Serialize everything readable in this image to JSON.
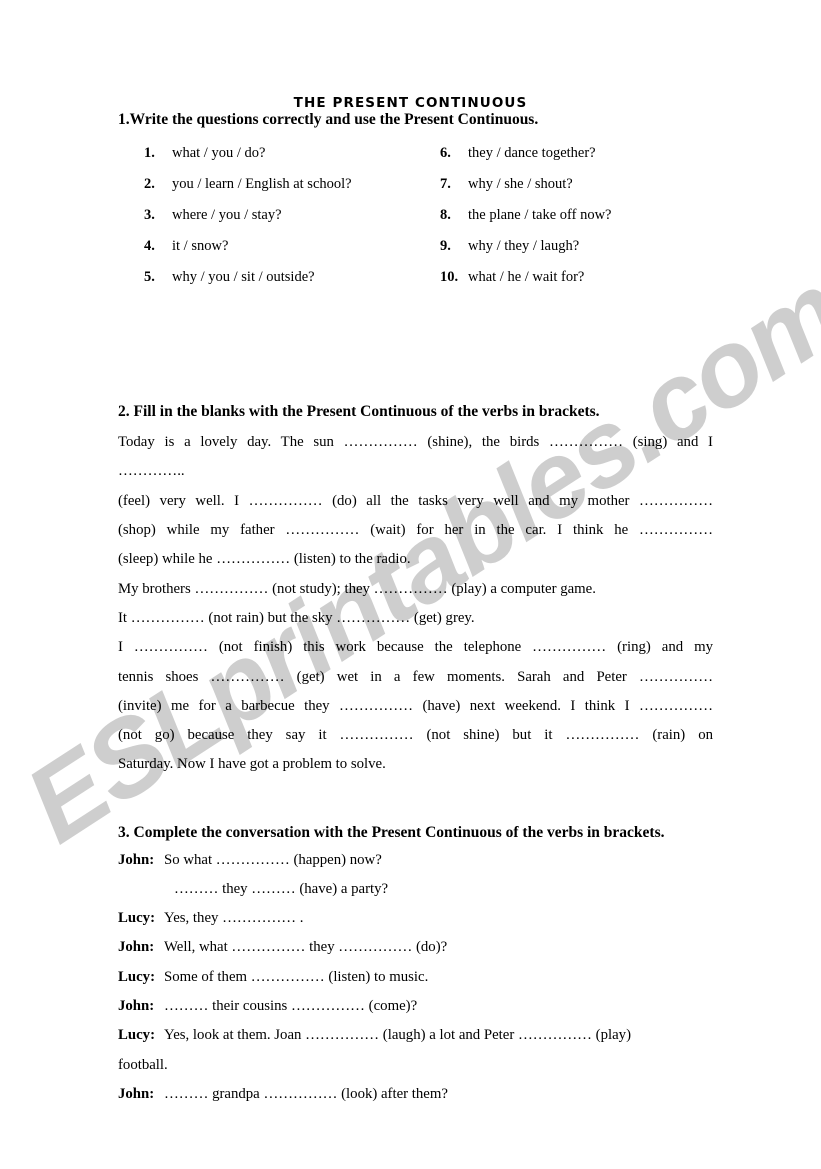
{
  "document": {
    "title": "THE PRESENT CONTINUOUS",
    "watermark": "ESLprintables.com",
    "watermark_color": "#cccccc",
    "page_background": "#ffffff",
    "text_color": "#000000",
    "blank_color": "#8e8e8e"
  },
  "exercise1": {
    "heading": "1.Write the questions correctly and use the Present Continuous.",
    "items_left": [
      {
        "num": "1.",
        "text": "what / you / do?"
      },
      {
        "num": "2.",
        "text": "you / learn / English at school?"
      },
      {
        "num": "3.",
        "text": "where / you / stay?"
      },
      {
        "num": "4.",
        "text": "it / snow?"
      },
      {
        "num": "5.",
        "text": "why / you / sit / outside?"
      }
    ],
    "items_right": [
      {
        "num": "6.",
        "text": "they / dance together?"
      },
      {
        "num": "7.",
        "text": "why / she / shout?"
      },
      {
        "num": "8.",
        "text": "the plane / take off now?"
      },
      {
        "num": "9.",
        "text": "why / they / laugh?"
      },
      {
        "num": "10.",
        "text": "what / he / wait for?"
      }
    ]
  },
  "exercise2": {
    "heading": "2. Fill in the blanks with the Present Continuous of the verbs in brackets.",
    "lines": [
      "Today is a lovely day. The sun …………… (shine), the birds …………… (sing) and I",
      "…………..",
      "(feel) very well. I …………… (do) all the tasks very well and my mother ……………",
      "(shop) while my father …………… (wait) for her in the car. I think he ……………",
      "(sleep) while he …………… (listen) to the radio.",
      "My brothers …………… (not study); they …………… (play) a computer game.",
      "It …………… (not rain) but the sky …………… (get) grey.",
      "I …………… (not finish) this work because the telephone …………… (ring) and my",
      "tennis shoes …………… (get) wet in a few moments. Sarah and Peter ……………",
      "(invite) me for a barbecue they …………… (have) next weekend. I think I ……………",
      "(not go) because they say it …………… (not shine) but it …………… (rain) on",
      "Saturday. Now I have got a problem to solve."
    ]
  },
  "exercise3": {
    "heading": "3. Complete the conversation with the Present Continuous of the verbs in brackets.",
    "lines": [
      {
        "speaker": "John:",
        "text": "So what …………… (happen) now?",
        "style": "normal"
      },
      {
        "speaker": "",
        "text": "……… they ……… (have) a party?",
        "style": "indented"
      },
      {
        "speaker": "Lucy:",
        "text": "Yes, they …………… .",
        "style": "normal"
      },
      {
        "speaker": "John:",
        "text": "Well, what …………… they …………… (do)?",
        "style": "normal"
      },
      {
        "speaker": "Lucy:",
        "text": "Some of them …………… (listen) to music.",
        "style": "normal"
      },
      {
        "speaker": "John:",
        "text": "……… their cousins …………… (come)?",
        "style": "normal"
      },
      {
        "speaker": "Lucy:",
        "text": "Yes, look at them. Joan …………… (laugh) a lot and Peter …………… (play)",
        "style": "normal"
      },
      {
        "speaker": "",
        "text": "football.",
        "style": "cont"
      },
      {
        "speaker": "John:",
        "text": "……… grandpa …………… (look) after them?",
        "style": "normal"
      }
    ]
  }
}
